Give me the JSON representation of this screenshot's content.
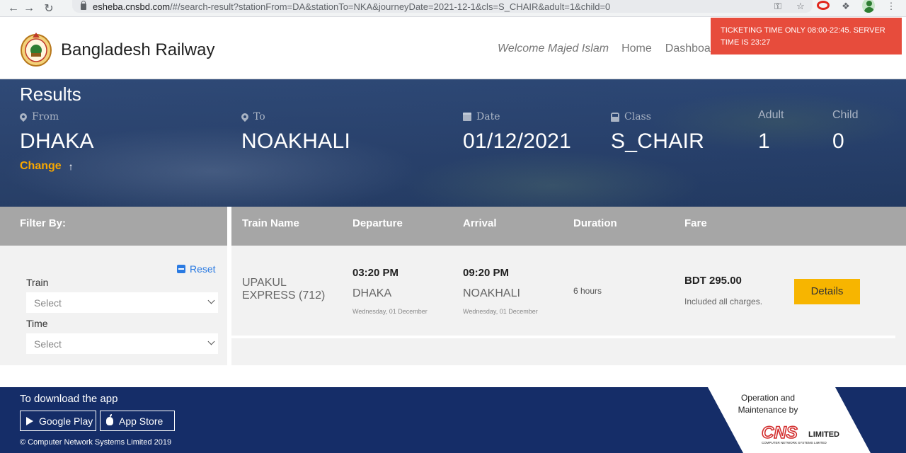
{
  "browser": {
    "url_host": "esheba.cnsbd.com",
    "url_rest": "/#/search-result?stationFrom=DA&stationTo=NKA&journeyDate=2021-12-1&cls=S_CHAIR&adult=1&child=0"
  },
  "header": {
    "brand": "Bangladesh Railway",
    "welcome": "Welcome Majed Islam",
    "nav": {
      "home": "Home",
      "dashboard": "Dashboard"
    },
    "alert": "TICKETING TIME ONLY 08:00-22:45. SERVER TIME IS 23:27"
  },
  "search": {
    "title": "Results",
    "from_label": "From",
    "from": "DHAKA",
    "to_label": "To",
    "to": "NOAKHALI",
    "date_label": "Date",
    "date": "01/12/2021",
    "class_label": "Class",
    "class": "S_CHAIR",
    "adult_label": "Adult",
    "adult": "1",
    "child_label": "Child",
    "child": "0",
    "change": "Change"
  },
  "filter": {
    "title": "Filter By:",
    "reset": "Reset",
    "train_label": "Train",
    "train_value": "Select",
    "time_label": "Time",
    "time_value": "Select"
  },
  "table": {
    "headers": {
      "train_name": "Train Name",
      "departure": "Departure",
      "arrival": "Arrival",
      "duration": "Duration",
      "fare": "Fare"
    },
    "rows": [
      {
        "train_name": "UPAKUL EXPRESS (712)",
        "dep_time": "03:20 PM",
        "dep_station": "DHAKA",
        "dep_date": "Wednesday, 01 December",
        "arr_time": "09:20 PM",
        "arr_station": "NOAKHALI",
        "arr_date": "Wednesday, 01 December",
        "duration": "6 hours",
        "fare": "BDT 295.00",
        "fare_note": "Included all charges.",
        "action": "Details"
      }
    ]
  },
  "footer": {
    "download": "To download the app",
    "google_play": "Google Play",
    "app_store": "App Store",
    "copyright": "© Computer Network Systems Limited 2019",
    "ops": "Operation and Maintenance by",
    "cnsl_logo": "CNS LIMITED",
    "cnsl_tagline": "COMPUTER NETWORK SYSTEMS LIMITED"
  },
  "colors": {
    "accent_orange": "#f7a700",
    "alert_red": "#e74c3c",
    "hero_blue": "#27406b",
    "footer_navy": "#152d68",
    "details_yellow": "#f7b500"
  }
}
